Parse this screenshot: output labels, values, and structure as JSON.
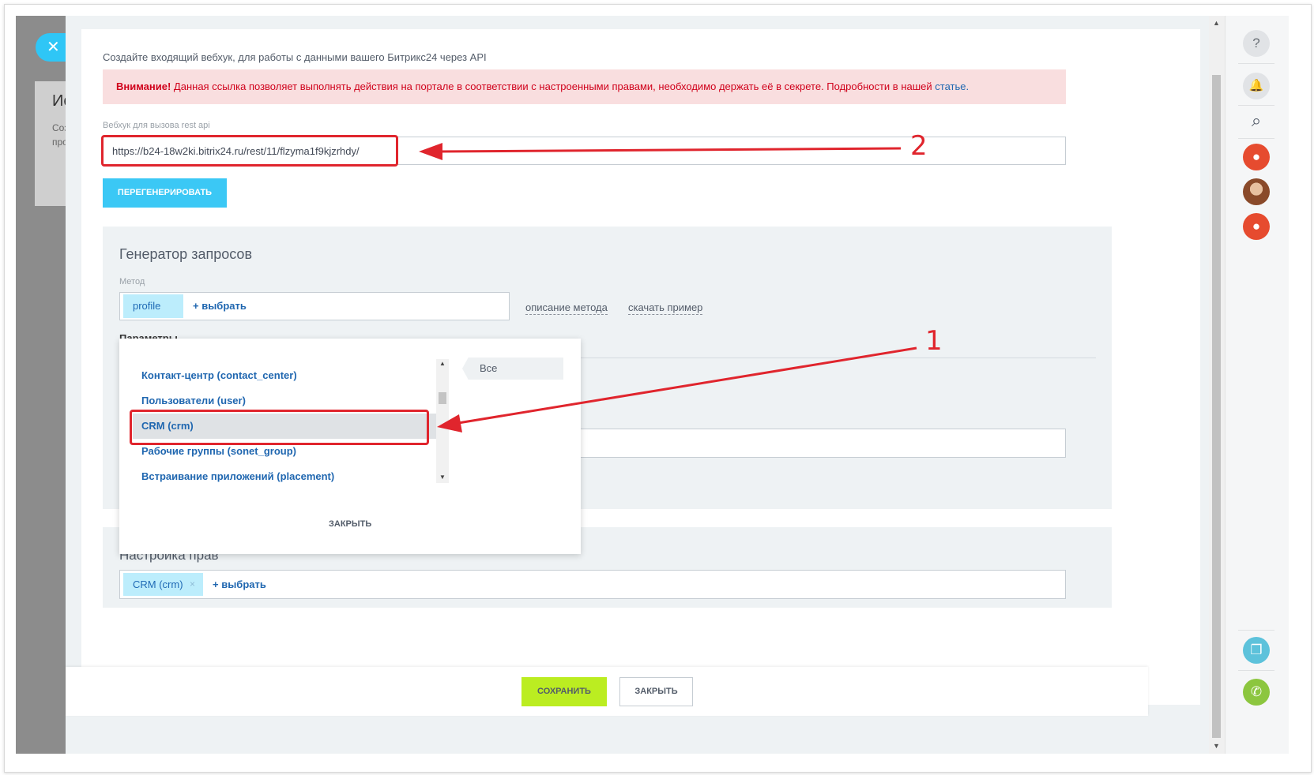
{
  "background": {
    "card_title": "Ис",
    "card_text": "Соз про"
  },
  "slider": {
    "close_icon": "close-icon"
  },
  "webhook": {
    "intro": "Создайте входящий вебхук, для работы с данными вашего Битрикс24 через API",
    "warning_bold": "Внимание!",
    "warning_text": " Данная ссылка позволяет выполнять действия на портале в соответствии с настроенными правами, необходимо держать её в секрете. Подробности в нашей ",
    "warning_link": "статье.",
    "label": "Вебхук для вызова rest api",
    "url": "https://b24-18w2ki.bitrix24.ru/rest/11/flzyma1f9kjzrhdy/",
    "regenerate_button": "ПЕРЕГЕНЕРИРОВАТЬ"
  },
  "generator": {
    "title": "Генератор запросов",
    "method_label": "Метод",
    "method_tag": "profile",
    "add_select": "+  выбрать",
    "method_description_link": "описание метода",
    "download_example_link": "скачать пример",
    "params_label": "Параметры"
  },
  "popup": {
    "items": [
      {
        "label": "Контакт-центр (contact_center)",
        "active": false
      },
      {
        "label": "Пользователи (user)",
        "active": false
      },
      {
        "label": "CRM (crm)",
        "active": true
      },
      {
        "label": "Рабочие группы (sonet_group)",
        "active": false
      },
      {
        "label": "Встраивание приложений (placement)",
        "active": false
      }
    ],
    "tab_all": "Все",
    "close": "ЗАКРЫТЬ"
  },
  "rights": {
    "title": "Настройка прав",
    "tag": "CRM (crm)",
    "tag_remove": "×",
    "add_select": "+  выбрать"
  },
  "footer": {
    "save": "СОХРАНИТЬ",
    "close": "ЗАКРЫТЬ"
  },
  "annotations": {
    "label_1": "1",
    "label_2": "2",
    "color": "#e0252d"
  },
  "rightbar": {
    "icons": [
      "help-icon",
      "bell-icon",
      "search-icon",
      "user-avatar-icon",
      "user-photo",
      "user-avatar-icon",
      "copy-call-icon",
      "phone-icon"
    ],
    "help_glyph": "?",
    "bell_glyph": "🔔",
    "search_glyph": "⌕",
    "user_glyph": "●",
    "copy_glyph": "❐",
    "phone_glyph": "✆"
  },
  "colors": {
    "accent_blue": "#3bc8f5",
    "save_green": "#bbed21",
    "warning_bg": "#f9dedf",
    "warning_text": "#d0011b",
    "link_blue": "#2067b0"
  }
}
